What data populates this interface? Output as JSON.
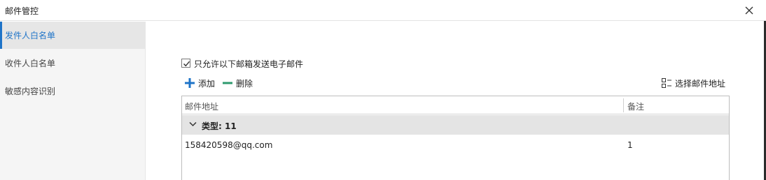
{
  "window": {
    "title": "邮件管控",
    "close_icon": "close-icon"
  },
  "sidebar": {
    "items": [
      {
        "label": "发件人白名单",
        "active": true
      },
      {
        "label": "收件人白名单",
        "active": false
      },
      {
        "label": "敏感内容识别",
        "active": false
      }
    ]
  },
  "main": {
    "checkbox": {
      "label": "只允许以下邮箱发送电子邮件",
      "checked": true
    },
    "toolbar": {
      "add_label": "添加",
      "add_icon": "plus-icon",
      "delete_label": "删除",
      "delete_icon": "minus-icon",
      "select_label": "选择邮件地址",
      "select_icon": "address-list-icon"
    },
    "table": {
      "columns": [
        "邮件地址",
        "备注"
      ],
      "group": {
        "label": "类型: 11",
        "expanded": true
      },
      "rows": [
        {
          "email": "158420598@qq.com",
          "note": "1"
        }
      ]
    }
  },
  "colors": {
    "accent": "#1f74c8",
    "add_icon": "#1f74c8",
    "delete_icon": "#2e9a6e",
    "sidebar_bg": "#f5f5f5",
    "group_row_bg": "#e4e4e4"
  }
}
